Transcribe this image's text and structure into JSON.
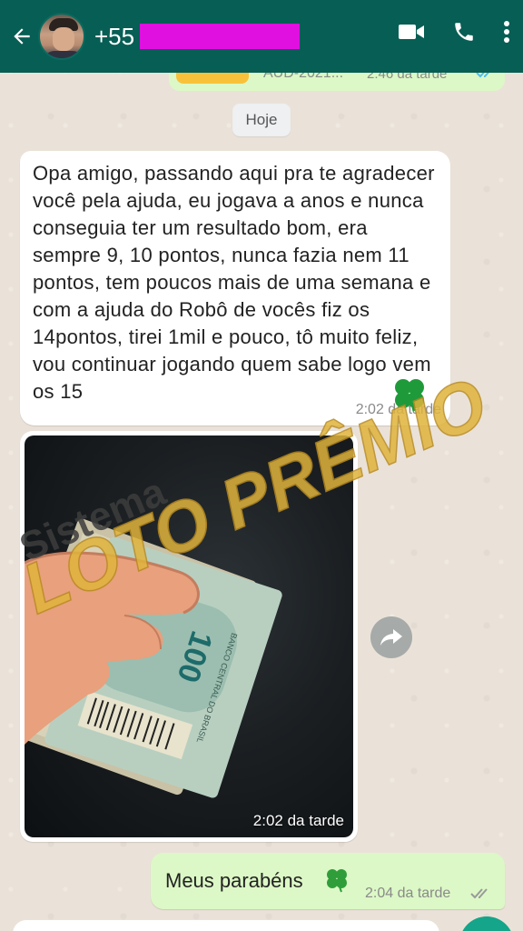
{
  "header": {
    "contact_prefix": "+55",
    "icons": [
      "back-arrow-icon",
      "video-call-icon",
      "phone-icon",
      "more-vert-icon"
    ],
    "background": "#075e54"
  },
  "top_message": {
    "doc_label": "AUD-2021...",
    "time": "2:46 da tarde"
  },
  "date_divider": "Hoje",
  "incoming_message": {
    "text": "Opa amigo, passando aqui pra te agradecer você pela ajuda, eu jogava a anos e nunca conseguia ter um resultado bom, era sempre 9, 10 pontos, nunca fazia nem 11 pontos, tem poucos mais de uma semana e com a ajuda do Robô de vocês fiz os 14pontos, tirei 1mil e pouco, tô muito feliz, vou continuar jogando quem sabe logo vem os 15",
    "time": "2:02 da tarde"
  },
  "image_message": {
    "time": "2:02 da tarde",
    "banknote_value": "100",
    "banknote_text": "BANCO CENTRAL DO BRASIL"
  },
  "outgoing_message": {
    "text": "Meus parabéns",
    "time": "2:04 da tarde"
  },
  "watermark": {
    "line1": "Sistema",
    "line2": "LOTO PRÊMIO"
  },
  "colors": {
    "outgoing_bubble": "#dcf8c6",
    "incoming_bubble": "#ffffff",
    "watermark_gold": "#e0b43c",
    "accent": "#14a58a"
  }
}
